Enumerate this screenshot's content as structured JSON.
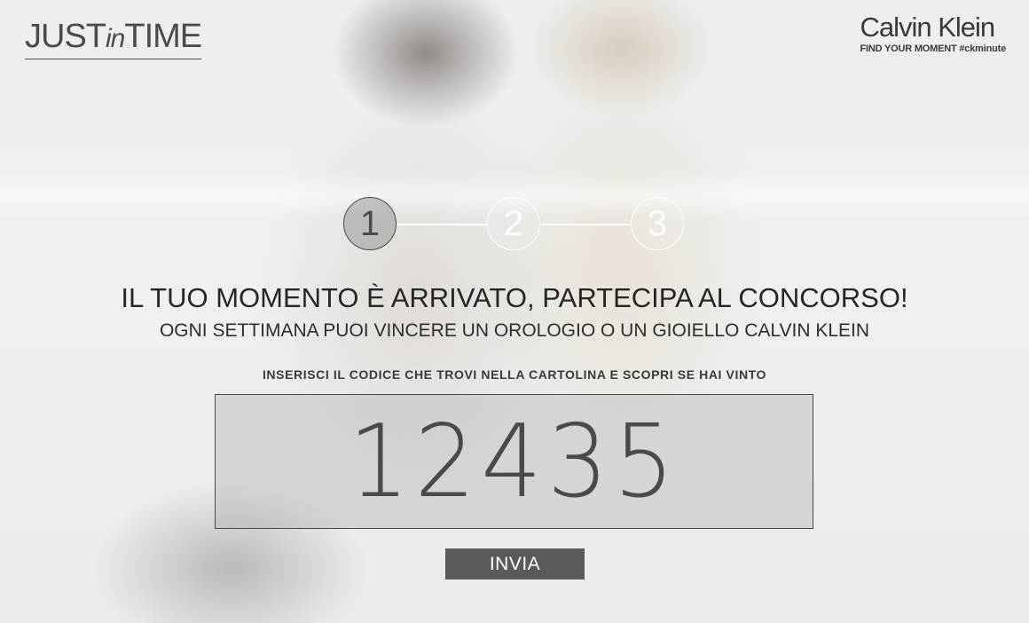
{
  "logo_left": {
    "text_1": "JUST",
    "text_2": "in",
    "text_3": "TIME"
  },
  "brand": {
    "name": "Calvin Klein",
    "tagline": "FIND YOUR MOMENT #ckminute"
  },
  "steps": [
    {
      "label": "1",
      "state": "active"
    },
    {
      "label": "2",
      "state": "inactive"
    },
    {
      "label": "3",
      "state": "inactive"
    }
  ],
  "headline": "IL TUO MOMENTO È ARRIVATO, PARTECIPA AL CONCORSO!",
  "subline": "OGNI SETTIMANA PUOI VINCERE UN OROLOGIO O UN GIOIELLO CALVIN KLEIN",
  "instruction": "INSERISCI IL CODICE CHE TROVI NELLA CARTOLINA E SCOPRI SE HAI VINTO",
  "code_input": {
    "value": "12435"
  },
  "submit": {
    "label": "INVIA"
  },
  "colors": {
    "accent": "#5b5a5a",
    "text": "#262626"
  }
}
